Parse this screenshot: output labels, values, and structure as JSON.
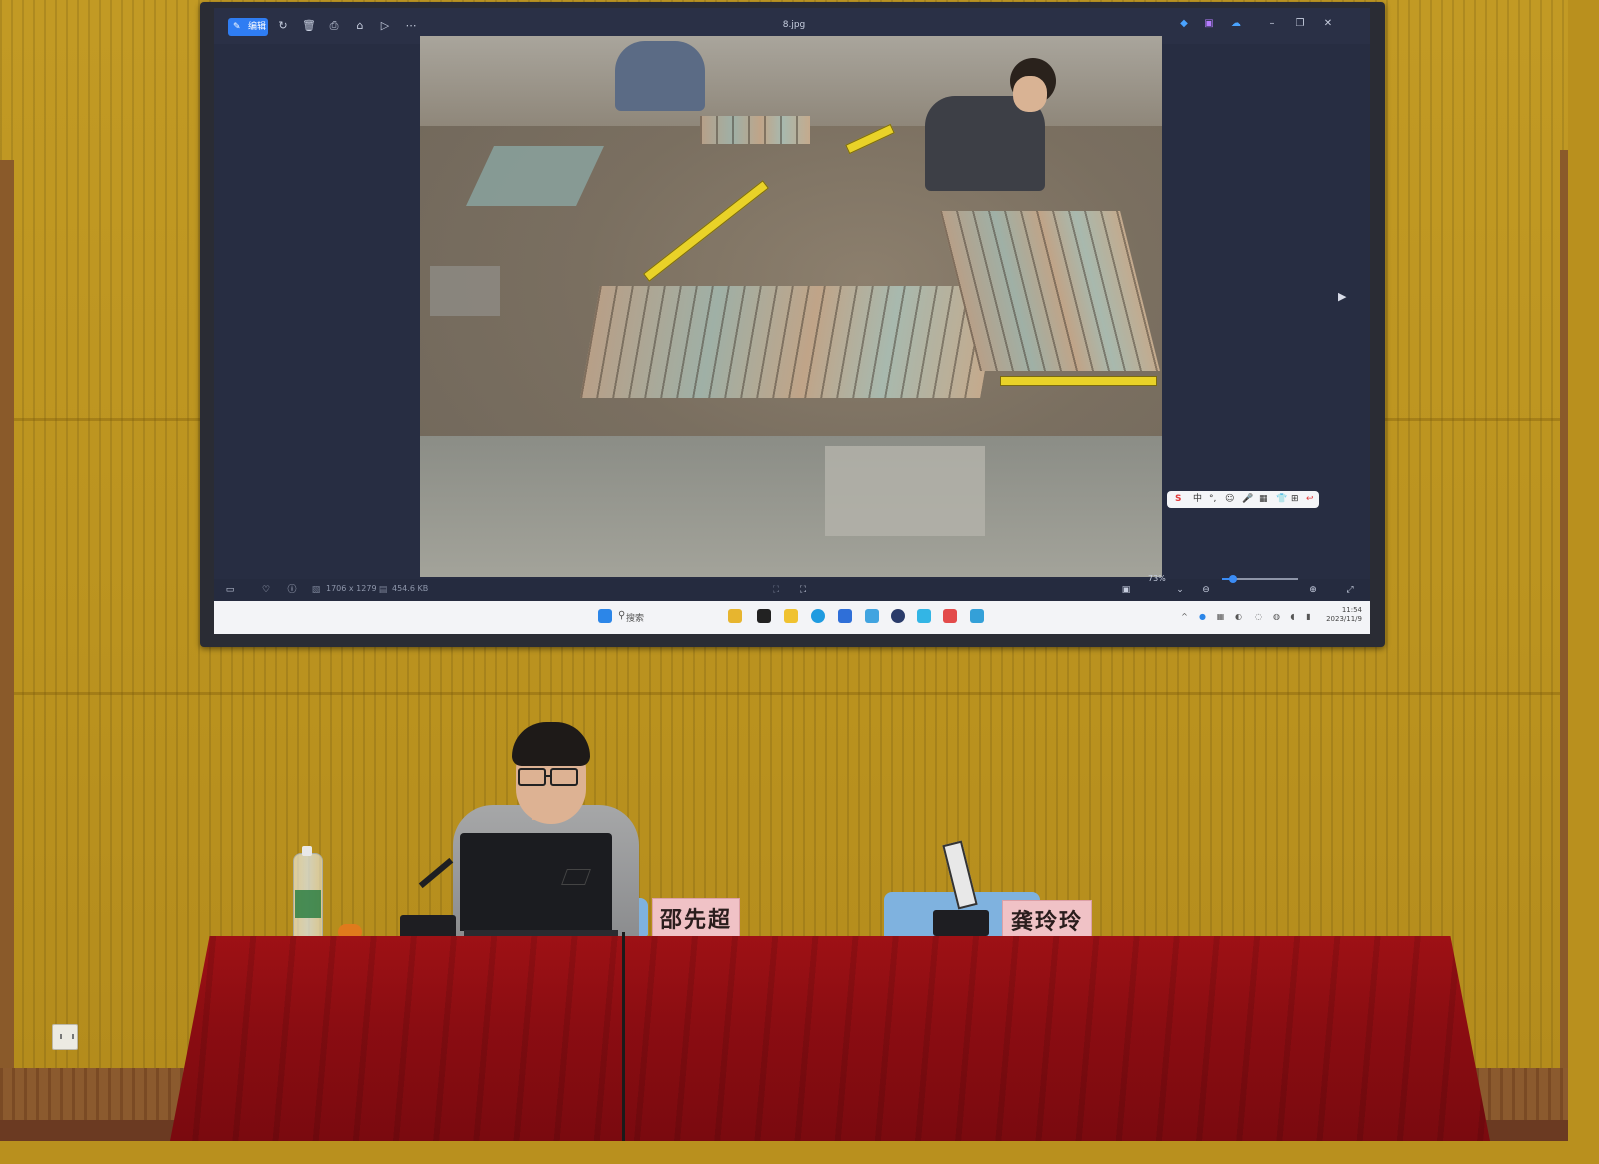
{
  "viewer": {
    "edit_label": "编辑",
    "file_name": "8.jpg",
    "status_dimensions": "1706 x 1279",
    "status_size": "454.6 KB",
    "zoom": "73%",
    "zoom_level": 0.14
  },
  "ime": {
    "items": [
      "S",
      "中",
      "°,",
      "☺",
      "🎤",
      "▦",
      "👕",
      "⊞",
      "↩"
    ]
  },
  "taskbar": {
    "search_label": "搜索",
    "clock_time": "11:54",
    "clock_date": "2023/11/9"
  },
  "stage": {
    "nameplate_left": "邵先超",
    "nameplate_right": "龚玲玲"
  },
  "colors": {
    "wall": "#c29a24",
    "tablecloth": "#8c0d12",
    "screen_bg": "#272d42",
    "accent": "#2f7df3",
    "nameplate": "#f0c2c6"
  }
}
